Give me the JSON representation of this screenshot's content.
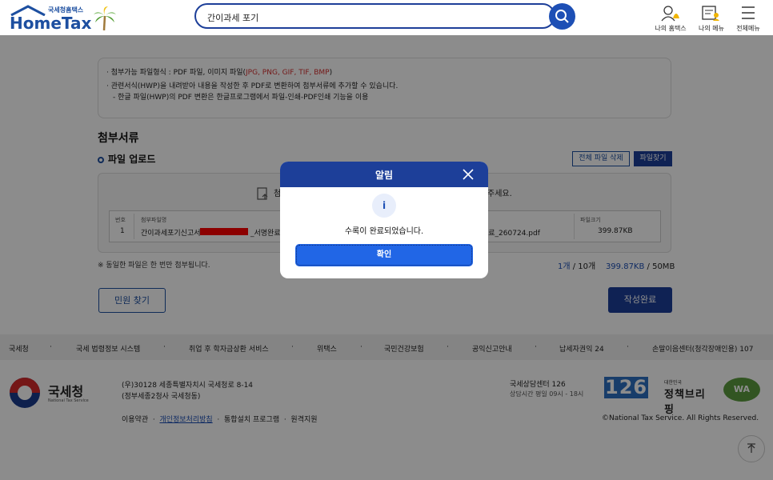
{
  "header": {
    "logo_sub": "국세청홈택스",
    "logo_main": "HomeTax",
    "search_value": "간이과세 포기",
    "icons": [
      {
        "label": "나의 홈택스",
        "icon": "user-bell-icon"
      },
      {
        "label": "나의 메뉴",
        "icon": "user-menu-icon"
      },
      {
        "label": "전체메뉴",
        "icon": "hamburger-icon"
      }
    ]
  },
  "info": {
    "line1_prefix": "· 첨부가능 파일형식 : PDF 파일, 이미지 파일(",
    "line1_red": "JPG, PNG, GIF, TIF, BMP",
    "line1_suffix": ")",
    "line2": "· 관련서식(HWP)을 내려받아 내용을 작성한 후 PDF로 변환하여 첨부서류에 추가할 수 있습니다.",
    "line3": "- 한글 파일(HWP)의 PDF 변환은 한글프로그램에서 파일-인쇄-PDF인쇄 기능을 이용"
  },
  "attach": {
    "section_title": "첨부서류",
    "upload_title": "파일 업로드",
    "delete_all": "전체 파일 삭제",
    "find_file": "파일찾기",
    "hint_left": "첨",
    "hint_right": "주세요.",
    "col_no": "번호",
    "col_name": "첨부파일명",
    "col_size": "파일크기",
    "row_no": "1",
    "row_name_a": "간이과세포기신고서",
    "row_name_b": "_서명완료_",
    "row_name_c": "완료_260724.pdf",
    "row_size": "399.87KB",
    "dup_note": "※ 동일한 파일은 한 번만 첨부됩니다.",
    "count_a": "1개",
    "count_b": " / 10개",
    "size_a": "399.87KB",
    "size_b": " / 50MB",
    "civil_btn": "민원 찾기",
    "done_btn": "작성완료"
  },
  "footer": {
    "links": [
      "국세청",
      "국세 법령정보 시스템",
      "취업 후 학자금상환 서비스",
      "위택스",
      "국민건강보험",
      "공익신고안내",
      "납세자권익 24",
      "손말이음센터(청각장애인용) 107"
    ],
    "org_name": "국세청",
    "org_en": "National Tax Service",
    "addr1": "(우)30128 세종특별자치시 국세청로 8-14",
    "addr2": "(정부세종2청사 국세청동)",
    "terms": "이용약관",
    "privacy": "개인정보처리방침",
    "install": "통합설치 프로그램",
    "remote": "원격지원",
    "cc1": "국세상담센터 126",
    "cc2": "상담시간 평일 09시 - 18시",
    "b126": "126",
    "policy_top": "대한민국",
    "policy_main": "정책브리핑",
    "wa": "WA",
    "copyright": "©National Tax Service. All Rights Reserved."
  },
  "modal": {
    "title": "알림",
    "icon_glyph": "i",
    "message": "수록이 완료되었습니다.",
    "ok": "확인"
  }
}
